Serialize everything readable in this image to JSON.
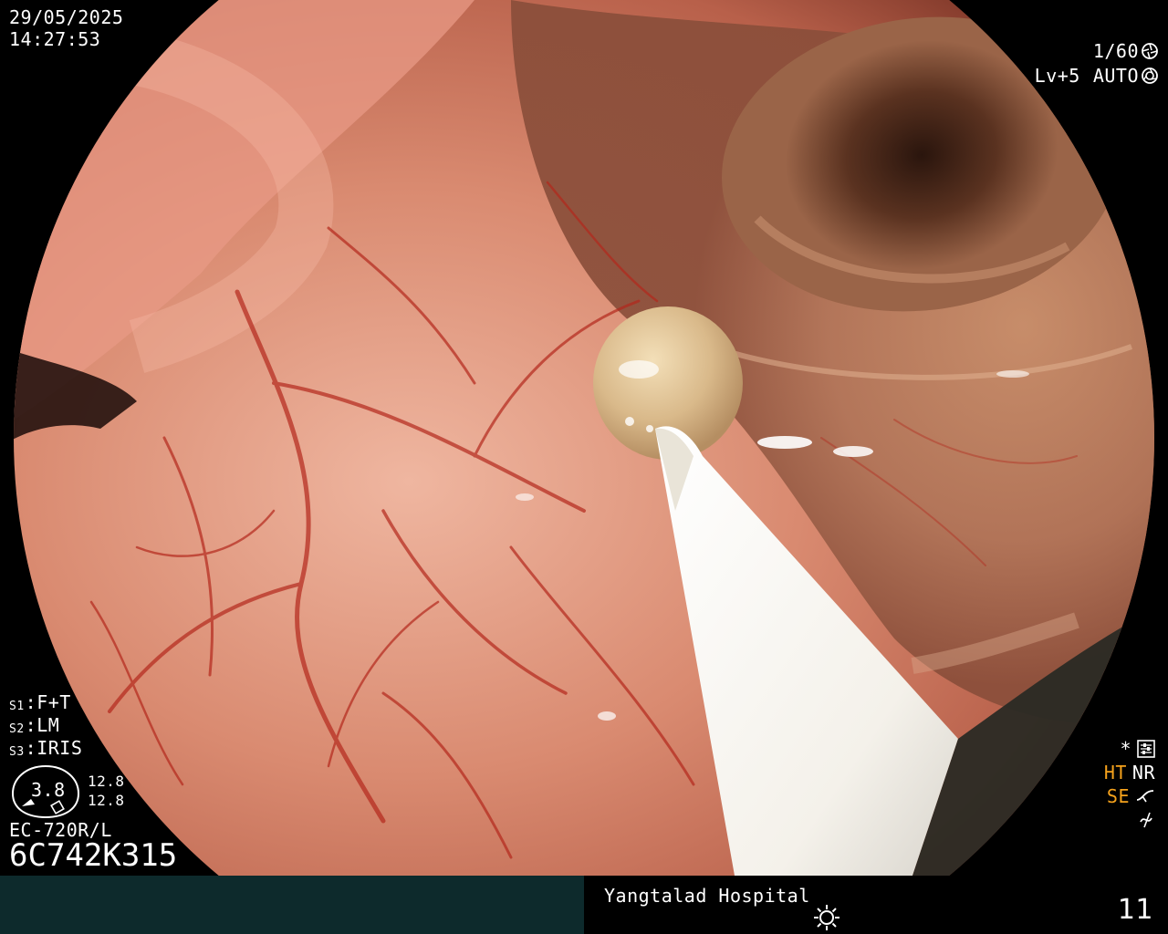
{
  "datetime": {
    "date": "29/05/2025",
    "time": "14:27:53"
  },
  "shutter": {
    "speed": "1/60",
    "speed_icon": "shutter-icon",
    "level": "Lv+5",
    "mode": "AUTO",
    "mode_icon": "iris-icon"
  },
  "settings": {
    "s1_key": "S1",
    "s1_value": ":F+T",
    "s2_key": "S2",
    "s2_value": ":LM",
    "s3_key": "S3",
    "s3_value": ":IRIS"
  },
  "zoom": {
    "value": "3.8",
    "top": "12.8",
    "bottom": "12.8"
  },
  "scope": {
    "model": "EC-720R/L",
    "serial": "6C742K315"
  },
  "right_flags": {
    "star": "*",
    "star_icon": "menu-sliders-icon",
    "ht": "HT",
    "nr": "NR",
    "se": "SE",
    "se_icon": "curve-icon",
    "last_icon": "freeze-off-icon",
    "accent_color": "#f5a21c"
  },
  "footer": {
    "hospital": "Yangtalad Hospital",
    "light_icon": "light-source-icon",
    "number": "11",
    "panel_color": "#0d2a2c"
  }
}
